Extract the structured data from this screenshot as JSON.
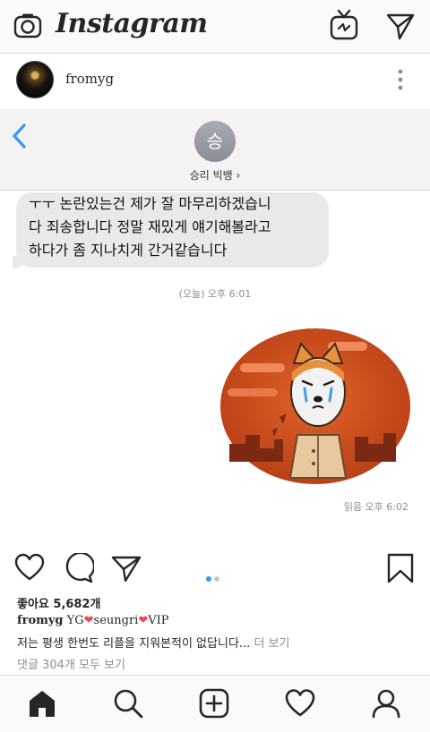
{
  "app": {
    "logo_text": "Instagram"
  },
  "post": {
    "username": "fromyg",
    "likes": "좋아요 5,682개",
    "caption_user": "fromyg",
    "caption_part1": "YG",
    "caption_part2": "seungri",
    "caption_part3": "VIP",
    "caption_line2": "저는 평생 한번도 리플을 지워본적이 없답니다...",
    "more_label": "더 보기",
    "comments_label": "댓글 304개 모두 보기",
    "carousel": {
      "count": 2,
      "active": 0
    }
  },
  "screenshot": {
    "contact_initial": "승",
    "contact_name": "승리 빅뱅 ›",
    "message": "ㅜㅜ 논란있는건 제가 잘 마무리하겠습니\n다 죄송합니다 정말 재밌게 얘기해볼라고\n하다가 좀 지나치게 간거같습니다",
    "time_label": "(오늘) 오후 6:01",
    "read_label": "읽음 오후 6:02"
  },
  "icons": {
    "camera": "camera-icon",
    "igtv": "igtv-icon",
    "direct": "direct-message-icon",
    "more": "more-options-icon",
    "back": "back-chevron-icon",
    "like": "heart-icon",
    "comment": "comment-icon",
    "share": "share-icon",
    "save": "bookmark-icon",
    "home": "home-icon",
    "search": "search-icon",
    "add": "add-post-icon",
    "activity": "activity-heart-icon",
    "profile": "profile-icon"
  },
  "colors": {
    "accent_blue": "#3897f0",
    "heart_red": "#ed4956",
    "sticker_bg": "#d4551f"
  }
}
